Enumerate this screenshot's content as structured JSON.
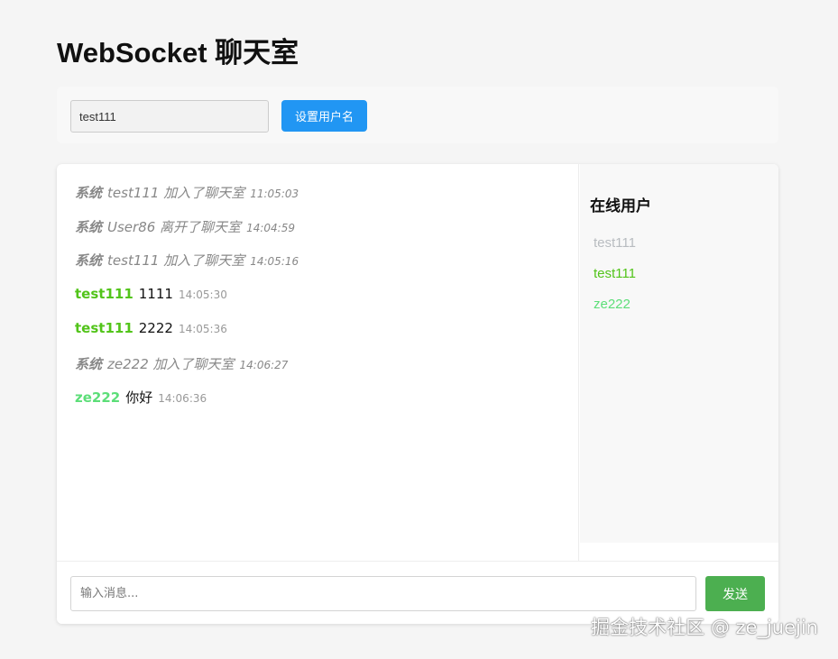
{
  "page": {
    "title": "WebSocket 聊天室"
  },
  "user_bar": {
    "username_value": "test111",
    "set_name_label": "设置用户名"
  },
  "messages": [
    {
      "type": "system",
      "sender": "系统",
      "text": "test111 加入了聊天室",
      "time": "11:05:03"
    },
    {
      "type": "system",
      "sender": "系统",
      "text": "User86 离开了聊天室",
      "time": "14:04:59"
    },
    {
      "type": "system",
      "sender": "系统",
      "text": "test111 加入了聊天室",
      "time": "14:05:16"
    },
    {
      "type": "user",
      "sender": "test111",
      "sender_color": "#52c41a",
      "text": "1111",
      "time": "14:05:30"
    },
    {
      "type": "user",
      "sender": "test111",
      "sender_color": "#52c41a",
      "text": "2222",
      "time": "14:05:36"
    },
    {
      "type": "system",
      "sender": "系统",
      "text": "ze222 加入了聊天室",
      "time": "14:06:27"
    },
    {
      "type": "user",
      "sender": "ze222",
      "sender_color": "#5cde78",
      "text": "你好",
      "time": "14:06:36"
    }
  ],
  "online": {
    "title": "在线用户",
    "users": [
      {
        "name": "test111",
        "color": "#b8bcc0"
      },
      {
        "name": "test111",
        "color": "#52c41a"
      },
      {
        "name": "ze222",
        "color": "#5cde78"
      }
    ]
  },
  "composer": {
    "placeholder": "输入消息...",
    "send_label": "发送"
  },
  "colors": {
    "primary_button": "#2196f3",
    "send_button": "#4caf50",
    "system_text": "#888888"
  },
  "watermark": "掘金技术社区 @ ze_juejin"
}
